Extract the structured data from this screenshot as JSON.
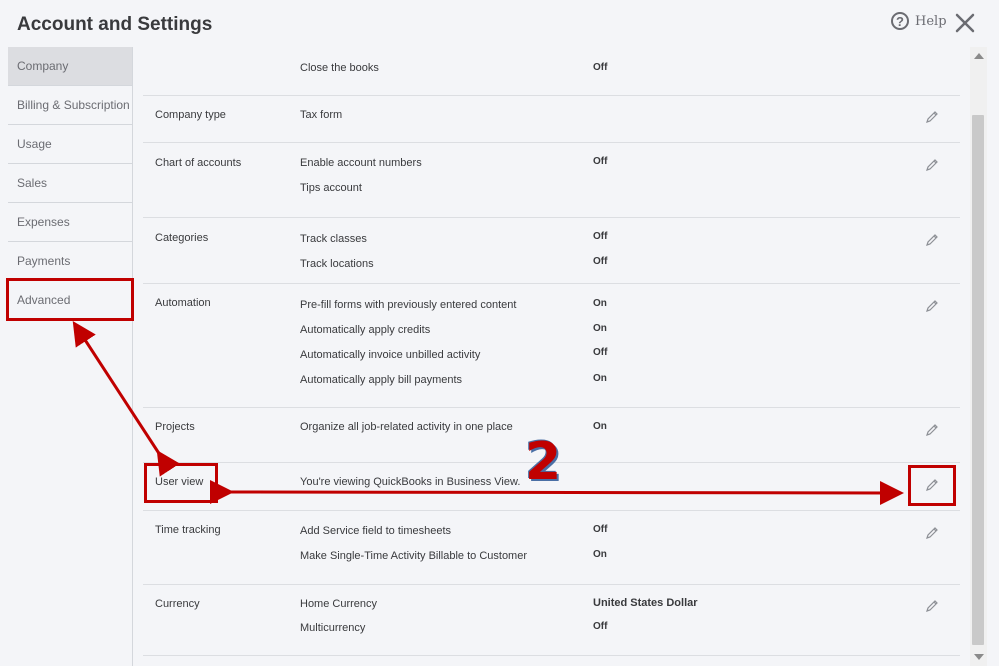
{
  "header": {
    "title": "Account and Settings",
    "help_label": "Help"
  },
  "sidebar": {
    "items": [
      {
        "label": "Company",
        "active": true
      },
      {
        "label": "Billing & Subscription"
      },
      {
        "label": "Usage"
      },
      {
        "label": "Sales"
      },
      {
        "label": "Expenses"
      },
      {
        "label": "Payments"
      },
      {
        "label": "Advanced"
      }
    ]
  },
  "sections": {
    "top": {
      "rows": [
        {
          "label": "Close the books",
          "value": "Off"
        }
      ]
    },
    "company_type": {
      "title": "Company type",
      "rows": [
        {
          "label": "Tax form"
        }
      ]
    },
    "chart_of_accounts": {
      "title": "Chart of accounts",
      "rows": [
        {
          "label": "Enable account numbers",
          "value": "Off"
        },
        {
          "label": "Tips account"
        }
      ]
    },
    "categories": {
      "title": "Categories",
      "rows": [
        {
          "label": "Track classes",
          "value": "Off"
        },
        {
          "label": "Track locations",
          "value": "Off"
        }
      ]
    },
    "automation": {
      "title": "Automation",
      "rows": [
        {
          "label": "Pre-fill forms with previously entered content",
          "value": "On"
        },
        {
          "label": "Automatically apply credits",
          "value": "On"
        },
        {
          "label": "Automatically invoice unbilled activity",
          "value": "Off"
        },
        {
          "label": "Automatically apply bill payments",
          "value": "On"
        }
      ]
    },
    "projects": {
      "title": "Projects",
      "rows": [
        {
          "label": "Organize all job-related activity in one place",
          "value": "On"
        }
      ]
    },
    "user_view": {
      "title": "User view",
      "rows": [
        {
          "label": "You're viewing QuickBooks in Business View."
        }
      ]
    },
    "time_tracking": {
      "title": "Time tracking",
      "rows": [
        {
          "label": "Add Service field to timesheets",
          "value": "Off"
        },
        {
          "label": "Make Single-Time Activity Billable to Customer",
          "value": "On"
        }
      ]
    },
    "currency": {
      "title": "Currency",
      "rows": [
        {
          "label": "Home Currency",
          "value": "United States Dollar"
        },
        {
          "label": "Multicurrency",
          "value": "Off"
        }
      ]
    }
  },
  "annotation": {
    "step_number": "2",
    "color": "#c00000"
  }
}
